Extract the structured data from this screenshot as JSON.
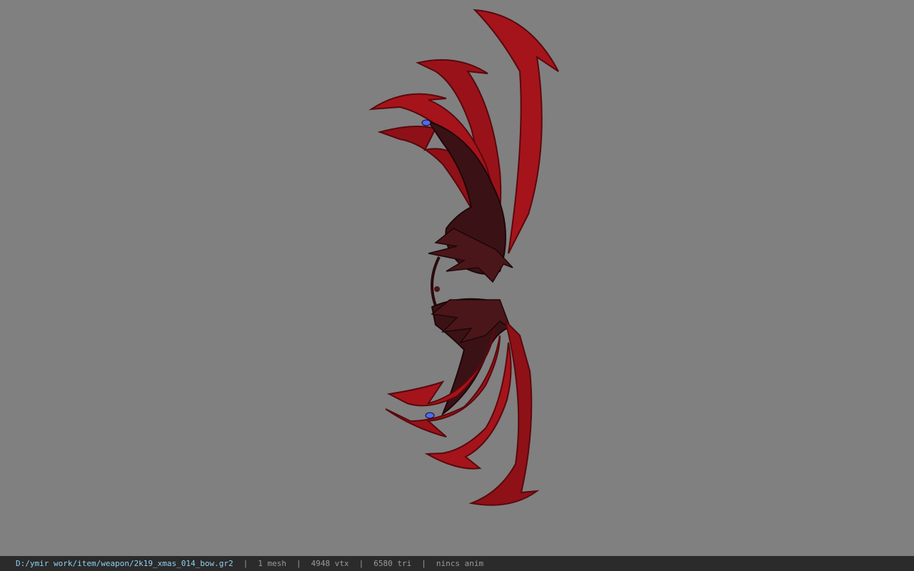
{
  "viewer": {
    "background_color": "#808080",
    "model_colors": {
      "blade": "#a5141b",
      "blade_dark": "#6a0a10",
      "body": "#3a1216",
      "gem": "#4a6cff"
    }
  },
  "status_bar": {
    "file_path": "D:/ymir work/item/weapon/2k19_xmas_014_bow.gr2",
    "mesh_count": "1 mesh",
    "vertex_count": "4948 vtx",
    "triangle_count": "6580 tri",
    "anim_status": "nincs anim",
    "separator": "|"
  }
}
